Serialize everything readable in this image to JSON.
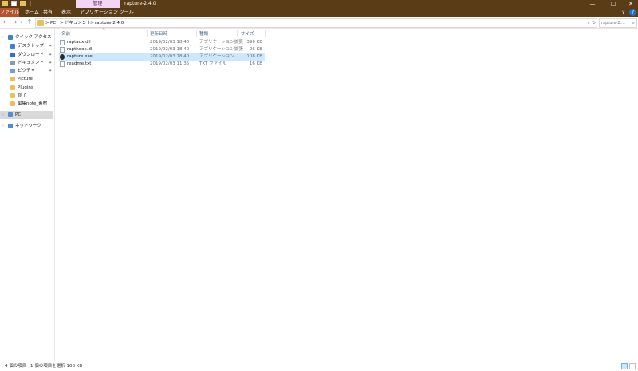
{
  "window": {
    "contextual_tab": "管理",
    "title": "rapture-2.4.0",
    "controls": {
      "minimize": "—",
      "maximize": "☐",
      "close": "✕"
    }
  },
  "ribbon": {
    "tabs": [
      "ファイル",
      "ホーム",
      "共有",
      "表示",
      "アプリケーション ツール"
    ],
    "expand_icon": "∨",
    "help_icon": "?"
  },
  "address": {
    "back_icon": "←",
    "forward_icon": "→",
    "recent_icon": "∨",
    "up_icon": "↑",
    "breadcrumbs": [
      "PC",
      "ドキュメント",
      "rapture-2.4.0"
    ],
    "separator": ">",
    "dropdown_icon": "∨",
    "refresh_icon": "↻",
    "search_placeholder": "rapture-2....",
    "search_icon": "⌕"
  },
  "nav": {
    "items": [
      {
        "label": "クイック アクセス",
        "icon": "star-icon",
        "color": "#3b82d6",
        "pinned": false
      },
      {
        "label": "デスクトップ",
        "icon": "desktop-icon",
        "color": "#3b82d6",
        "pinned": true
      },
      {
        "label": "ダウンロード",
        "icon": "download-icon",
        "color": "#2f6fc7",
        "pinned": true
      },
      {
        "label": "ドキュメント",
        "icon": "documents-icon",
        "color": "#8a9aaa",
        "pinned": true
      },
      {
        "label": "ピクチャ",
        "icon": "pictures-icon",
        "color": "#6aa0d8",
        "pinned": true
      },
      {
        "label": "Picture",
        "icon": "folder-icon",
        "color": "#e9c15b",
        "pinned": false
      },
      {
        "label": "Plugins",
        "icon": "folder-icon",
        "color": "#e9c15b",
        "pinned": false
      },
      {
        "label": "終了",
        "icon": "folder-icon",
        "color": "#e9c15b",
        "pinned": false
      },
      {
        "label": "編集note_素材",
        "icon": "folder-icon",
        "color": "#e9c15b",
        "pinned": false
      },
      {
        "label": "PC",
        "icon": "pc-icon",
        "color": "#4a90d9",
        "pinned": false,
        "selected": true
      },
      {
        "label": "ネットワーク",
        "icon": "network-icon",
        "color": "#4a90d9",
        "pinned": false
      }
    ],
    "pin_glyph": "✦",
    "expander_glyph": "›"
  },
  "files": {
    "sort_caret": "^",
    "columns": {
      "name": "名前",
      "date": "更新日時",
      "type": "種類",
      "size": "サイズ"
    },
    "rows": [
      {
        "name": "raptaux.dll",
        "date": "2019/02/03 18:40",
        "type": "アプリケーション拡張",
        "size": "396 KB",
        "kind": "dll"
      },
      {
        "name": "rapthook.dll",
        "date": "2019/02/03 18:40",
        "type": "アプリケーション拡張",
        "size": "26 KB",
        "kind": "dll"
      },
      {
        "name": "rapture.exe",
        "date": "2019/02/03 18:40",
        "type": "アプリケーション",
        "size": "108 KB",
        "kind": "exe",
        "selected": true
      },
      {
        "name": "readme.txt",
        "date": "2019/02/03 11:35",
        "type": "TXT ファイル",
        "size": "16 KB",
        "kind": "txt"
      }
    ]
  },
  "status": {
    "item_count": "4 個の項目",
    "selection": "1 個の項目を選択  108 KB"
  },
  "colors": {
    "titlebar": "#5a3c17",
    "file_tab": "#b4532c",
    "manage_tab": "#f2d6f4",
    "selection": "#cce8ff"
  }
}
